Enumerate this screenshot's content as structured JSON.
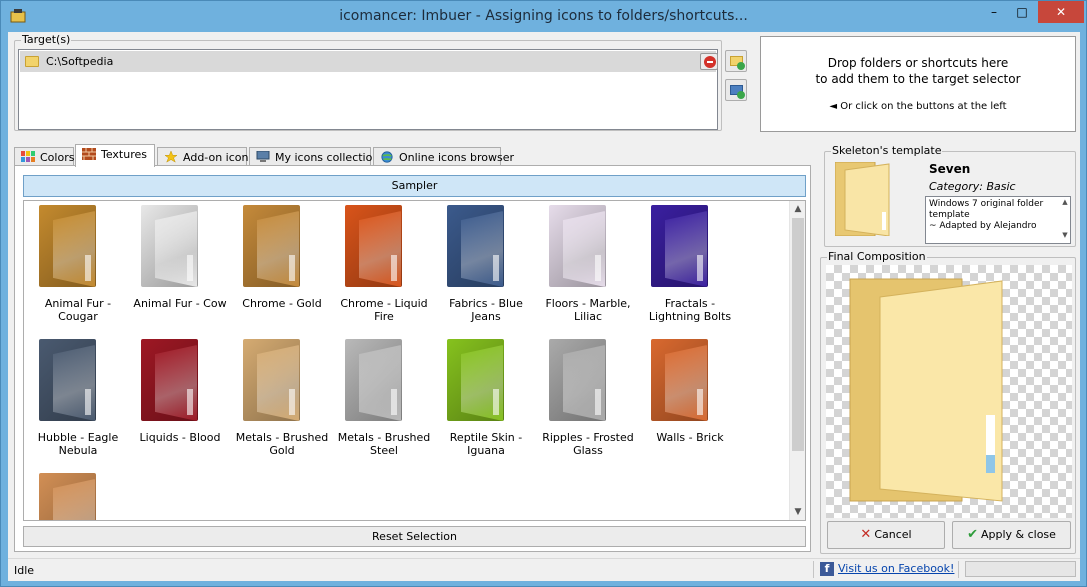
{
  "window": {
    "title": "icomancer: Imbuer - Assigning icons to folders/shortcuts...",
    "minimize": "–",
    "maximize": "□",
    "close": "✕"
  },
  "target": {
    "legend": "Target(s)",
    "items": [
      {
        "path": "C:\\Softpedia"
      }
    ]
  },
  "drop_zone": {
    "line1": "Drop folders or shortcuts here",
    "line2": "to add them to the target selector",
    "line3": "◄ Or click on the buttons at the left"
  },
  "tabs": [
    {
      "label": "Colors",
      "icon": "color-grid-icon"
    },
    {
      "label": "Textures",
      "icon": "brick-texture-icon",
      "active": true
    },
    {
      "label": "Add-on icons",
      "icon": "star-icon"
    },
    {
      "label": "My icons collection",
      "icon": "computer-icon"
    },
    {
      "label": "Online icons browser",
      "icon": "globe-icon"
    }
  ],
  "sampler_label": "Sampler",
  "reset_label": "Reset Selection",
  "textures": [
    {
      "label": "Animal Fur - Cougar",
      "color": "#c48a2e"
    },
    {
      "label": "Animal Fur - Cow",
      "color": "#e8e8e8"
    },
    {
      "label": "Chrome - Gold",
      "color": "#c58a3a"
    },
    {
      "label": "Chrome - Liquid Fire",
      "color": "#d9541a"
    },
    {
      "label": "Fabrics - Blue Jeans",
      "color": "#3b5a8c"
    },
    {
      "label": "Floors - Marble, Liliac",
      "color": "#e6dcea"
    },
    {
      "label": "Fractals - Lightning Bolts",
      "color": "#3a1fa0"
    },
    {
      "label": "Hubble - Eagle Nebula",
      "color": "#4a5a70"
    },
    {
      "label": "Liquids - Blood",
      "color": "#9e1824"
    },
    {
      "label": "Metals - Brushed Gold",
      "color": "#d5ab72"
    },
    {
      "label": "Metals - Brushed Steel",
      "color": "#b9b9b9"
    },
    {
      "label": "Reptile Skin - Iguana",
      "color": "#86c21e"
    },
    {
      "label": "Ripples - Frosted Glass",
      "color": "#aaaaaa"
    },
    {
      "label": "Walls - Brick",
      "color": "#d9692f"
    },
    {
      "label": "",
      "color": "#d28f55"
    }
  ],
  "skeleton": {
    "legend": "Skeleton's template",
    "name": "Seven",
    "category": "Category: Basic",
    "description": "Windows 7 original folder template\n~ Adapted by Alejandro"
  },
  "final": {
    "legend": "Final Composition",
    "cancel_label": "Cancel",
    "apply_label": "Apply & close"
  },
  "status": {
    "text": "Idle",
    "facebook_link": "Visit us on Facebook!"
  },
  "colors": {
    "folder_yellow": "#f5dc8a",
    "accent_blue": "#6fb1de"
  }
}
